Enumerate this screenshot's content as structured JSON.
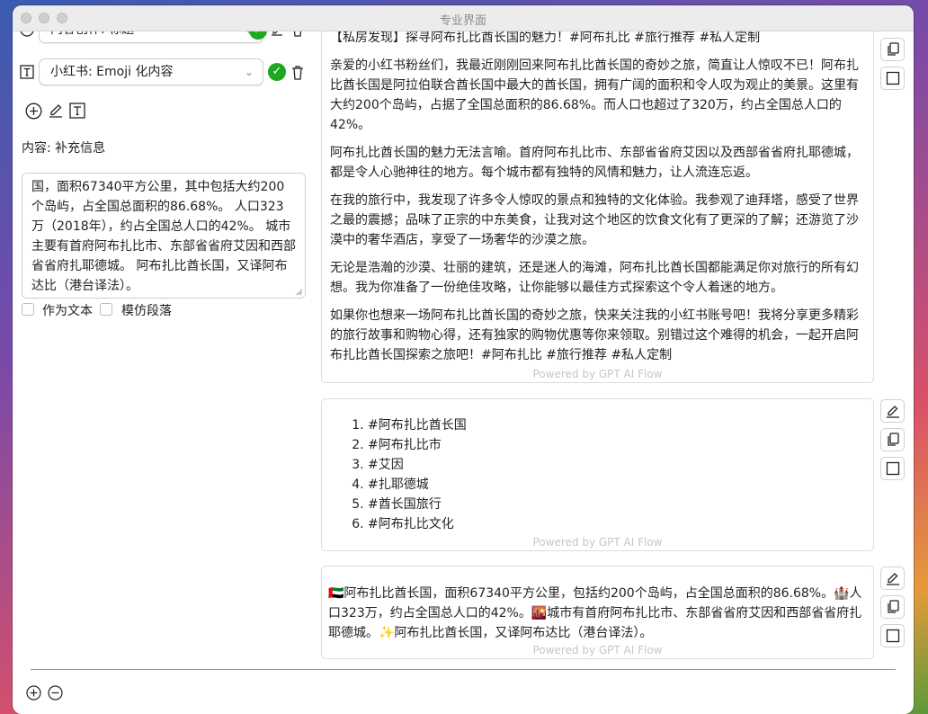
{
  "window": {
    "title": "专业界面"
  },
  "left": {
    "row1_select": "内容创作: 标题",
    "row2_select": "小红书: Emoji 化内容",
    "content_label": "内容: 补充信息",
    "textarea_value": "国，面积67340平方公里，其中包括大约200个岛屿，占全国总面积的86.68%。 人口323万（2018年），约占全国总人口的42%。 城市主要有首府阿布扎比市、东部省省府艾因和西部省省府扎耶德城。 阿布扎比酋长国，又译阿布达比（港台译法）。",
    "checkbox_as_text": "作为文本",
    "checkbox_imitate": "模仿段落"
  },
  "cards": {
    "powered": "Powered by GPT AI Flow",
    "card1": {
      "p1": "【私房发现】探寻阿布扎比酋长国的魅力！#阿布扎比 #旅行推荐 #私人定制",
      "p2": "亲爱的小红书粉丝们，我最近刚刚回来阿布扎比酋长国的奇妙之旅，简直让人惊叹不已！阿布扎比酋长国是阿拉伯联合酋长国中最大的酋长国，拥有广阔的面积和令人叹为观止的美景。这里有大约200个岛屿，占据了全国总面积的86.68%。而人口也超过了320万，约占全国总人口的42%。",
      "p3": "阿布扎比酋长国的魅力无法言喻。首府阿布扎比市、东部省省府艾因以及西部省省府扎耶德城，都是令人心驰神往的地方。每个城市都有独特的风情和魅力，让人流连忘返。",
      "p4": "在我的旅行中，我发现了许多令人惊叹的景点和独特的文化体验。我参观了迪拜塔，感受了世界之最的震撼；品味了正宗的中东美食，让我对这个地区的饮食文化有了更深的了解；还游览了沙漠中的奢华酒店，享受了一场奢华的沙漠之旅。",
      "p5": "无论是浩瀚的沙漠、壮丽的建筑，还是迷人的海滩，阿布扎比酋长国都能满足你对旅行的所有幻想。我为你准备了一份绝佳攻略，让你能够以最佳方式探索这个令人着迷的地方。",
      "p6": "如果你也想来一场阿布扎比酋长国的奇妙之旅，快来关注我的小红书账号吧！我将分享更多精彩的旅行故事和购物心得，还有独家的购物优惠等你来领取。别错过这个难得的机会，一起开启阿布扎比酋长国探索之旅吧！#阿布扎比 #旅行推荐 #私人定制"
    },
    "card2": {
      "items": [
        "#阿布扎比酋长国",
        "#阿布扎比市",
        "#艾因",
        "#扎耶德城",
        "#酋长国旅行",
        "#阿布扎比文化"
      ]
    },
    "card3": {
      "text": "🇦🇪阿布扎比酋长国，面积67340平方公里，包括约200个岛屿，占全国总面积的86.68%。🏰人口323万，约占全国总人口的42%。🌇城市有首府阿布扎比市、东部省省府艾因和西部省省府扎耶德城。✨阿布扎比酋长国，又译阿布达比（港台译法）。"
    }
  }
}
